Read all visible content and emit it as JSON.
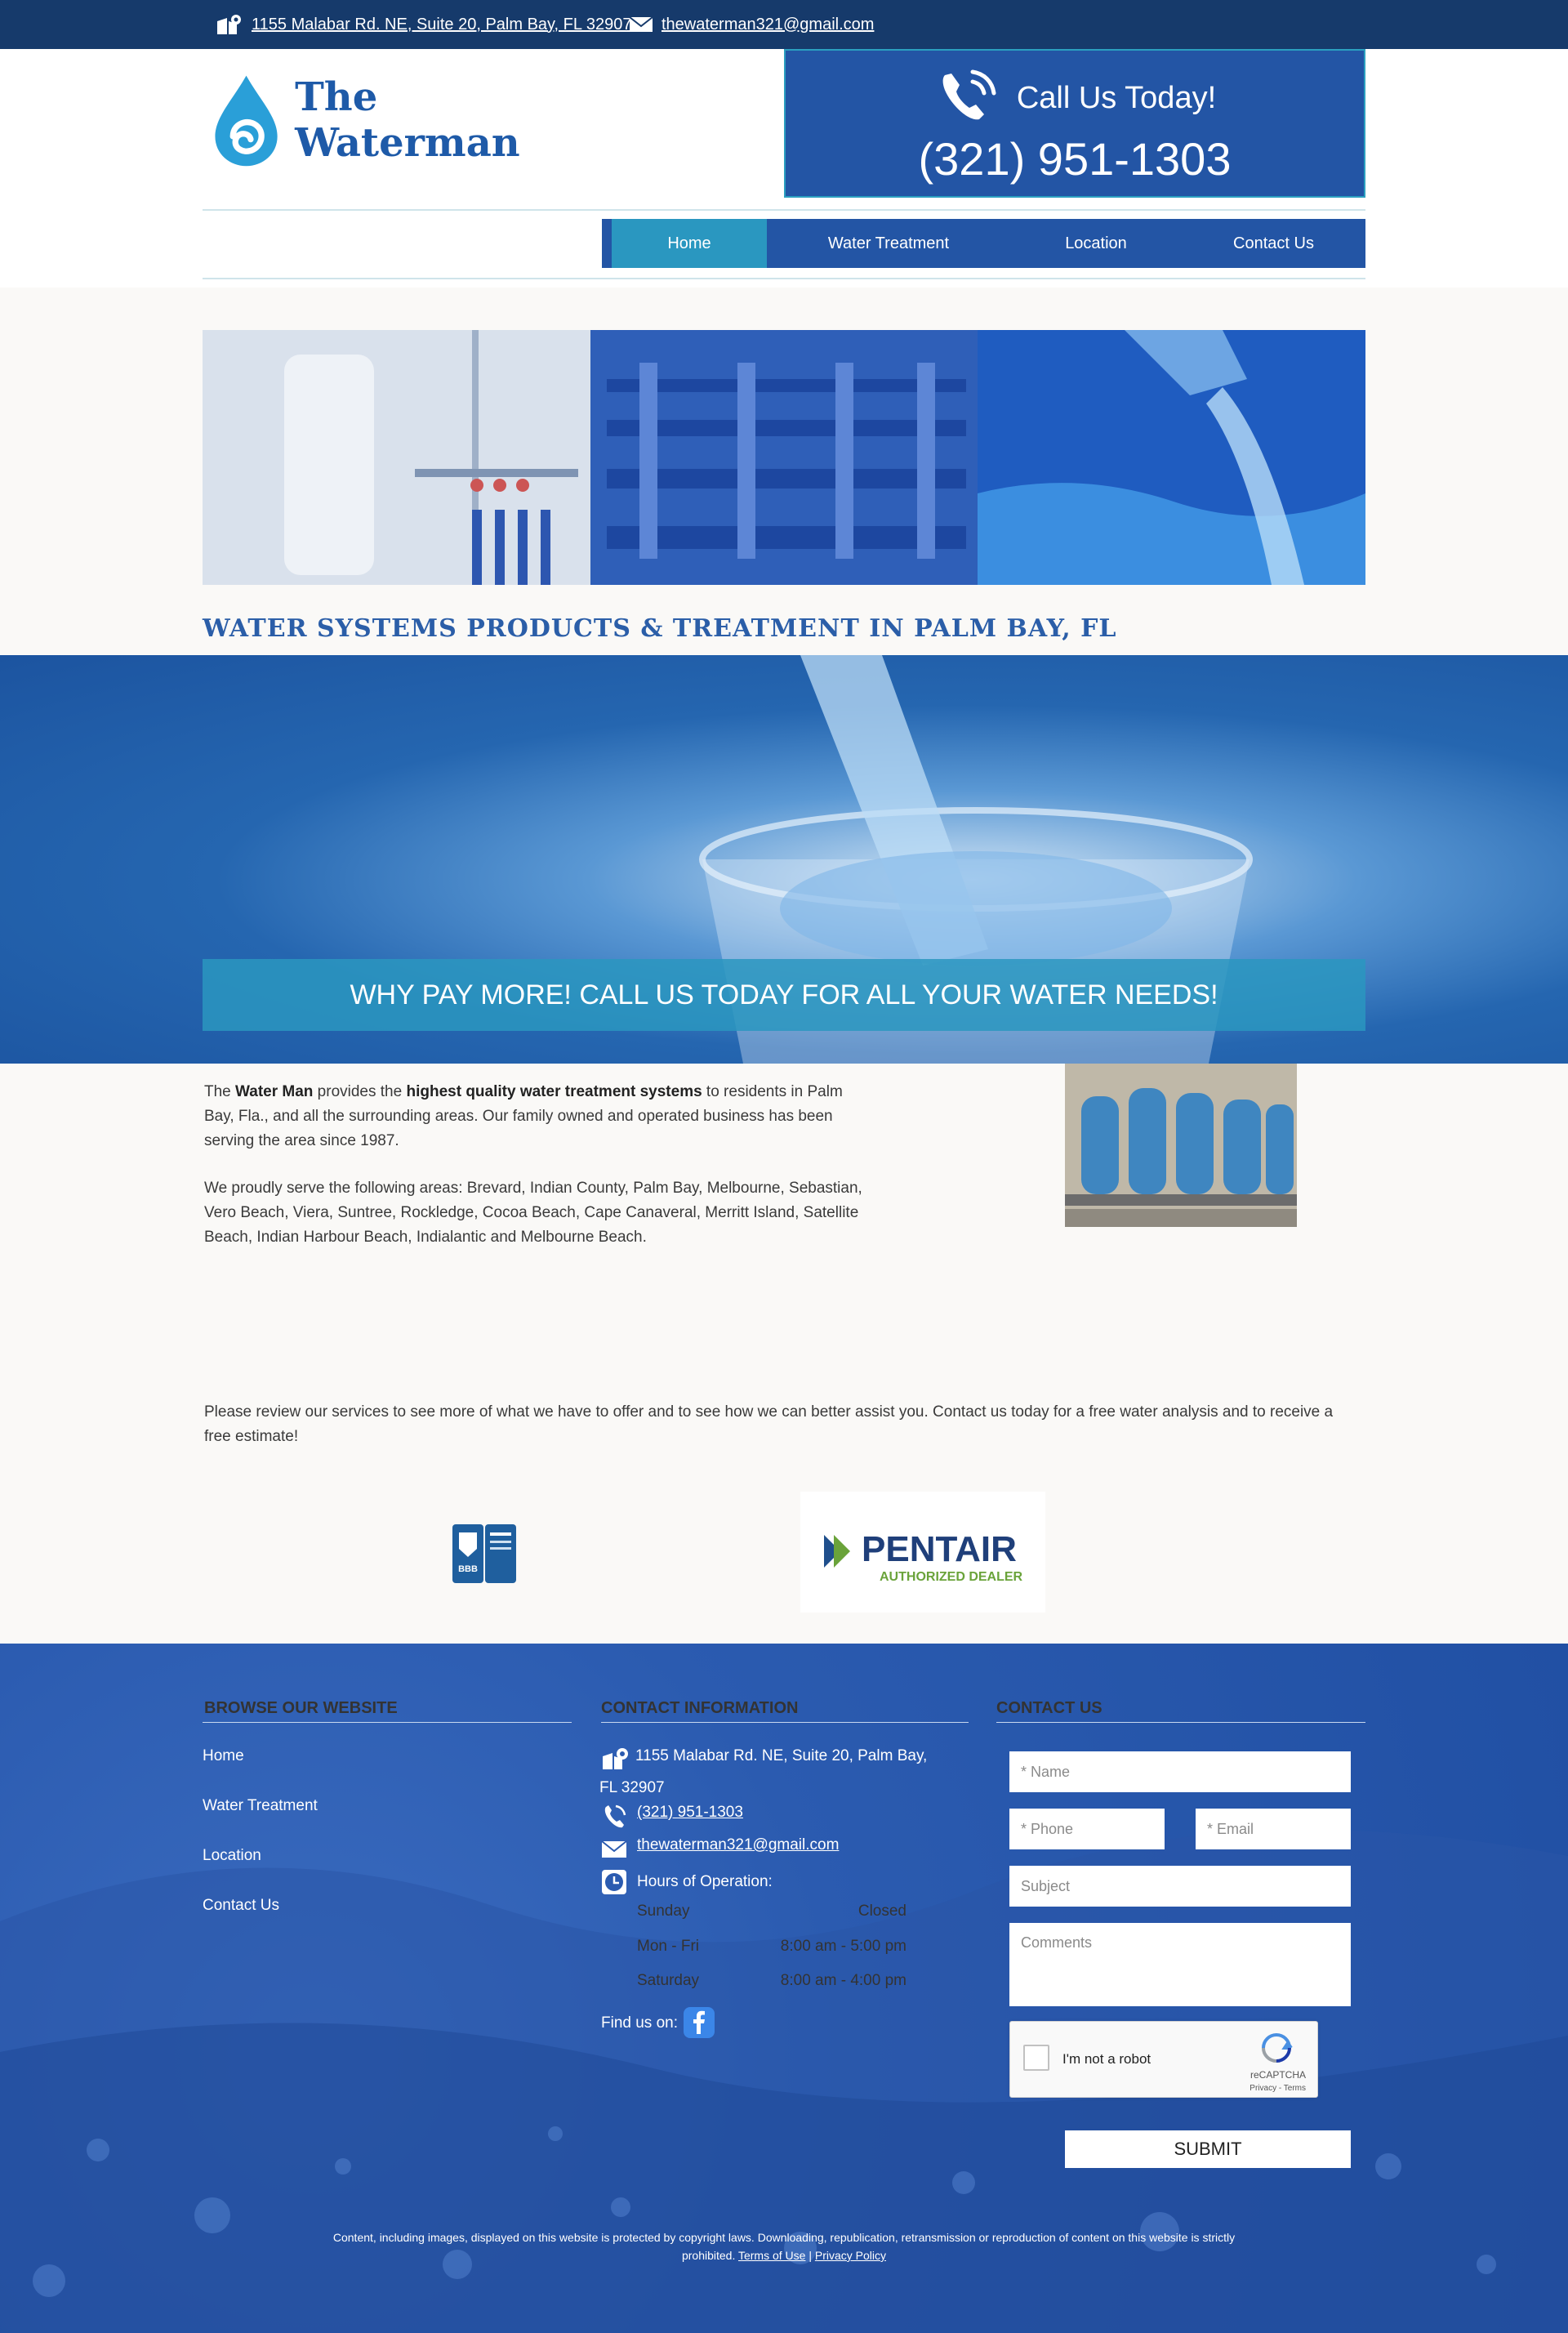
{
  "topbar": {
    "address": "1155 Malabar Rd. NE, Suite 20, Palm Bay, FL 32907",
    "email": "thewaterman321@gmail.com"
  },
  "header": {
    "brand": "The Waterman",
    "call_title": "Call Us Today!",
    "phone": "(321) 951-1303"
  },
  "nav": {
    "items": [
      {
        "label": "Home",
        "active": true
      },
      {
        "label": "Water Treatment"
      },
      {
        "label": "Location"
      },
      {
        "label": "Contact Us"
      }
    ]
  },
  "main": {
    "headline": "WATER SYSTEMS PRODUCTS & TREATMENT IN PALM BAY, FL",
    "banner": "WHY PAY MORE! CALL US TODAY FOR ALL YOUR WATER NEEDS!",
    "intro_1": "The ",
    "intro_brand": "Water Man",
    "intro_2": " provides the ",
    "intro_strong": "highest quality water treatment systems",
    "intro_3": " to residents in Palm Bay, Fla., and all the surrounding areas. Our family owned and operated business has been serving the area since 1987.",
    "areas": "We proudly serve the following areas: Brevard, Indian County, Palm Bay, Melbourne, Sebastian, Vero Beach, Viera, Suntree, Rockledge, Cocoa Beach, Cape Canaveral, Merritt Island, Satellite Beach, Indian Harbour Beach, Indialantic and Melbourne Beach.",
    "review": "Please review our services to see more of what we have to offer and to see how we can better assist you. Contact us today for a free water analysis and to receive a free estimate!",
    "bbb_label": "BBB",
    "pentair_name": "PENTAIR",
    "pentair_sub": "AUTHORIZED DEALER"
  },
  "footer": {
    "browse_title": "BROWSE OUR WEBSITE",
    "links": [
      "Home",
      "Water Treatment",
      "Location",
      "Contact Us"
    ],
    "contact_title": "CONTACT INFORMATION",
    "address_line1": "1155 Malabar Rd. NE, Suite 20, Palm Bay,",
    "address_line2": "FL 32907",
    "phone": "(321) 951-1303",
    "email": "thewaterman321@gmail.com",
    "hours_title": "Hours of Operation:",
    "hours": [
      {
        "day": "Sunday",
        "time": "Closed"
      },
      {
        "day": "Mon - Fri",
        "time": "8:00 am - 5:00 pm"
      },
      {
        "day": "Saturday",
        "time": "8:00 am - 4:00 pm"
      }
    ],
    "find_us": "Find us on:",
    "form_title": "CONTACT US",
    "form": {
      "name_placeholder": "* Name",
      "phone_placeholder": "* Phone",
      "email_placeholder": "* Email",
      "subject_placeholder": "Subject",
      "comments_placeholder": "Comments",
      "captcha_label": "I'm not a robot",
      "captcha_brand": "reCAPTCHA",
      "captcha_terms": "Privacy - Terms",
      "submit": "SUBMIT"
    },
    "copyright_1": "Content, including images, displayed on this website is protected by copyright laws. Downloading, republication, retransmission or reproduction of content on this website is strictly prohibited. ",
    "terms": "Terms of Use",
    "sep": " | ",
    "privacy": "Privacy Policy"
  },
  "colors": {
    "topbar": "#163a6b",
    "brand_blue": "#2355a5",
    "accent": "#2a97c0",
    "footer": "#2b5bb0"
  }
}
